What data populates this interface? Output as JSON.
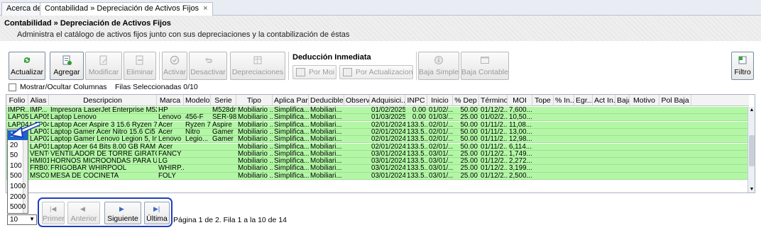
{
  "tabs": [
    {
      "label": "Acerca de",
      "active": false
    },
    {
      "label": "Contabilidad » Depreciación de Activos Fijos",
      "active": true,
      "close": "×"
    }
  ],
  "header": {
    "title": "Contabilidad » Depreciación de Activos Fijos",
    "subtitle": "Administra el catálogo de activos fijos junto con sus depreciaciones y la contabilización de éstas"
  },
  "toolbar": {
    "actualizar": "Actualizar",
    "agregar": "Agregar",
    "modificar": "Modificar",
    "eliminar": "Eliminar",
    "activar": "Activar",
    "desactivar": "Desactivar",
    "depreciaciones": "Depreciaciones",
    "deduccion_title": "Deducción Inmediata",
    "por_moi": "Por Moi",
    "por_actualizacion": "Por Actualizacion",
    "baja_simple": "Baja Simple",
    "baja_contable": "Baja Contable",
    "filtro": "Filtro"
  },
  "options": {
    "show_hide_columns": "Mostrar/Ocultar Columnas",
    "selected": "Filas Seleccionadas 0/10"
  },
  "grid": {
    "columns": [
      "Folio",
      "Alias",
      "Descripcion",
      "Marca",
      "Modelo",
      "Serie",
      "Tipo",
      "Aplica Para",
      "Deducible",
      "Observ...",
      "Adquisici...",
      "INPC",
      "Inicio",
      "% Dep",
      "Término",
      "MOI",
      "Tope",
      "% In...",
      "Egr...",
      "Act In...",
      "Baja",
      "Motivo",
      "Pol Baja"
    ],
    "rows": [
      [
        "IMPR...",
        "IMP...",
        "Impresora LaserJet Enterprise M528...",
        "HP",
        "",
        "M528dn",
        "Mobiliario ...",
        "Simplifica...",
        "Mobiliari...",
        "",
        "01/02/2025",
        "0.00",
        "01/02/...",
        "50.00",
        "01/12/2...",
        "7,600...."
      ],
      [
        "LAP05",
        "LAP05",
        "Laptop Lenovo",
        "Lenovo",
        "456-F",
        "SER-987",
        "Mobiliario ...",
        "Simplifica...",
        "Mobiliari...",
        "",
        "01/03/2025",
        "0.00",
        "01/03/...",
        "25.00",
        "01/02/2...",
        "10,50...."
      ],
      [
        "LAP04",
        "LAP04",
        "Laptop Acer Aspire 3 15.6 Ryzen 7, ...",
        "Acer",
        "Ryzen 7",
        "Aspire",
        "Mobiliario ...",
        "Simplifica...",
        "Mobiliari...",
        "",
        "02/01/2024",
        "133.5...",
        "02/01/...",
        "50.00",
        "01/11/2...",
        "11,08...."
      ],
      [
        "LAP03",
        "LAP03",
        "Laptop Gamer Acer Nitro 15.6 Ci5 8...",
        "Acer",
        "Nitro",
        "Gamer",
        "Mobiliario ...",
        "Simplifica...",
        "Mobiliari...",
        "",
        "02/01/2024",
        "133.5...",
        "02/01/...",
        "50.00",
        "01/11/2...",
        "13,00...."
      ],
      [
        "LAP02",
        "LAP02",
        "Laptop Gamer Lenovo Legion 5, Int...",
        "Lenovo",
        "Legio...",
        "Gamer",
        "Mobiliario ...",
        "Simplifica...",
        "Mobiliari...",
        "",
        "02/01/2024",
        "133.5...",
        "02/01/...",
        "50.00",
        "01/11/2...",
        "12,98...."
      ],
      [
        "LAP01",
        "LAP01",
        "Laptop Acer 64 Bits 8.00 GB RAM",
        "Acer",
        "",
        "",
        "Mobiliario ...",
        "Simplifica...",
        "Mobiliari...",
        "",
        "02/01/2024",
        "133.5...",
        "02/01/...",
        "50.00",
        "01/11/2...",
        "6,114...."
      ],
      [
        "VENT01",
        "VENT01",
        "VENTILADOR DE TORRE GIRATORIO",
        "FANCY",
        "",
        "",
        "Mobiliario ...",
        "Simplifica...",
        "Mobiliari...",
        "",
        "03/01/2024",
        "133.5...",
        "03/01/...",
        "25.00",
        "01/12/2...",
        "1,749...."
      ],
      [
        "HMIC01",
        "HMI01",
        "HORNOS MICROONDAS PARA US...",
        "LG",
        "",
        "",
        "Mobiliario ...",
        "Simplifica...",
        "Mobiliari...",
        "",
        "03/01/2024",
        "133.5...",
        "03/01/...",
        "25.00",
        "01/12/2...",
        "2,272...."
      ],
      [
        "FRB01",
        "FRB01",
        "FRIGOBAR WHIRPOOL",
        "WHIRP...",
        "",
        "",
        "Mobiliario ...",
        "Simplifica...",
        "Mobiliari...",
        "",
        "03/01/2024",
        "133.5...",
        "03/01/...",
        "25.00",
        "01/12/2...",
        "3,199...."
      ],
      [
        "MSC01",
        "MSC01",
        "MESA DE COCINETA",
        "FOLY",
        "",
        "",
        "Mobiliario ...",
        "Simplifica...",
        "Mobiliari...",
        "",
        "03/01/2024",
        "133.5...",
        "03/01/...",
        "25.00",
        "01/12/2...",
        "2,500...."
      ]
    ]
  },
  "page_size": {
    "options": [
      "10",
      "20",
      "50",
      "100",
      "500",
      "1000",
      "2000",
      "5000"
    ],
    "selected": "10"
  },
  "pager": {
    "first": "Primer",
    "prev": "Anterior",
    "next": "Siguiente",
    "last": "Última",
    "info": "Página 1 de 2. Fila 1 a la 10 de 14"
  },
  "colors": {
    "row_green": "#b3f7a6",
    "highlight_blue": "#1f3fbf"
  }
}
